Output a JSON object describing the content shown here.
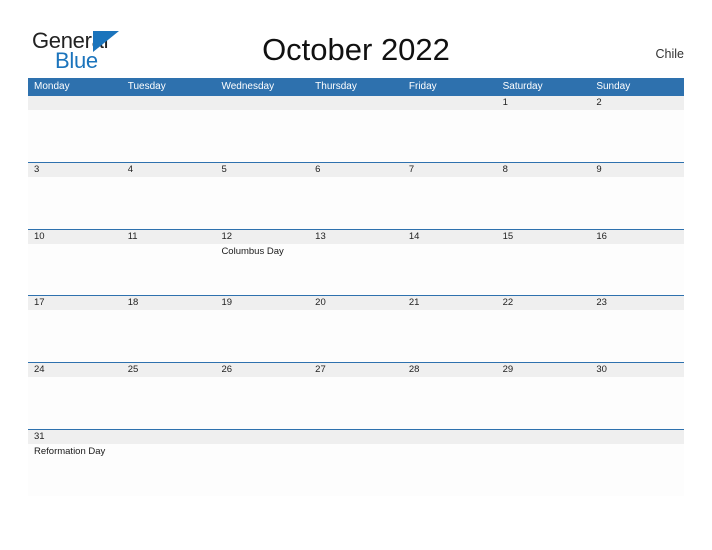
{
  "branding": {
    "logo_primary": "General",
    "logo_secondary": "Blue",
    "logo_icon": "blue-triangle-mark",
    "primary_color": "#1b74bc",
    "header_color": "#2e71ae",
    "band_color": "#efefef"
  },
  "header": {
    "title": "October 2022",
    "month": "October",
    "year": "2022",
    "country": "Chile"
  },
  "calendar": {
    "weekdays": [
      "Monday",
      "Tuesday",
      "Wednesday",
      "Thursday",
      "Friday",
      "Saturday",
      "Sunday"
    ],
    "weeks": [
      {
        "days": [
          {
            "num": "",
            "events": []
          },
          {
            "num": "",
            "events": []
          },
          {
            "num": "",
            "events": []
          },
          {
            "num": "",
            "events": []
          },
          {
            "num": "",
            "events": []
          },
          {
            "num": "1",
            "events": []
          },
          {
            "num": "2",
            "events": []
          }
        ]
      },
      {
        "days": [
          {
            "num": "3",
            "events": []
          },
          {
            "num": "4",
            "events": []
          },
          {
            "num": "5",
            "events": []
          },
          {
            "num": "6",
            "events": []
          },
          {
            "num": "7",
            "events": []
          },
          {
            "num": "8",
            "events": []
          },
          {
            "num": "9",
            "events": []
          }
        ]
      },
      {
        "days": [
          {
            "num": "10",
            "events": []
          },
          {
            "num": "11",
            "events": []
          },
          {
            "num": "12",
            "events": [
              "Columbus Day"
            ]
          },
          {
            "num": "13",
            "events": []
          },
          {
            "num": "14",
            "events": []
          },
          {
            "num": "15",
            "events": []
          },
          {
            "num": "16",
            "events": []
          }
        ]
      },
      {
        "days": [
          {
            "num": "17",
            "events": []
          },
          {
            "num": "18",
            "events": []
          },
          {
            "num": "19",
            "events": []
          },
          {
            "num": "20",
            "events": []
          },
          {
            "num": "21",
            "events": []
          },
          {
            "num": "22",
            "events": []
          },
          {
            "num": "23",
            "events": []
          }
        ]
      },
      {
        "days": [
          {
            "num": "24",
            "events": []
          },
          {
            "num": "25",
            "events": []
          },
          {
            "num": "26",
            "events": []
          },
          {
            "num": "27",
            "events": []
          },
          {
            "num": "28",
            "events": []
          },
          {
            "num": "29",
            "events": []
          },
          {
            "num": "30",
            "events": []
          }
        ]
      },
      {
        "days": [
          {
            "num": "31",
            "events": [
              "Reformation Day"
            ]
          },
          {
            "num": "",
            "events": []
          },
          {
            "num": "",
            "events": []
          },
          {
            "num": "",
            "events": []
          },
          {
            "num": "",
            "events": []
          },
          {
            "num": "",
            "events": []
          },
          {
            "num": "",
            "events": []
          }
        ]
      }
    ]
  }
}
